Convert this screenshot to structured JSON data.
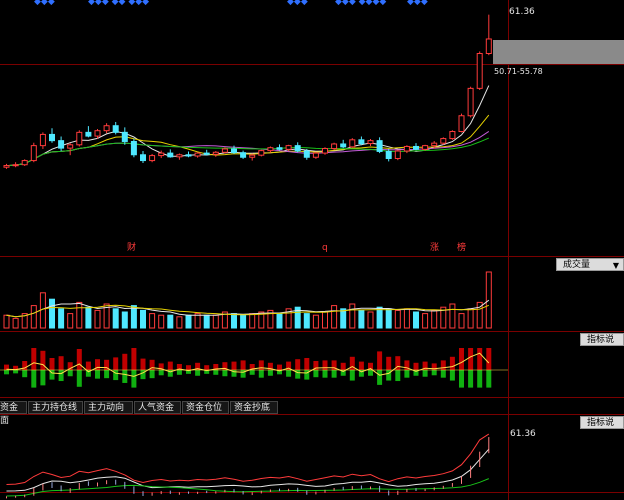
{
  "top_marks": [
    "◆◆◆",
    "◆◆◆ ◆◆ ◆◆◆",
    "◆◆◆",
    "◆◆◆ ◆◆◆◆",
    "◆◆◆"
  ],
  "colors": {
    "up": "#ff3b3b",
    "down": "#4fe8ff",
    "ma_white": "#e6e6e6",
    "ma_yellow": "#e6d200",
    "ma_green": "#19c019",
    "ma_purple": "#c35bd8",
    "grid": "#7a0000"
  },
  "main_chart": {
    "high_label": "61.36",
    "range_label": "50.71-55.78",
    "event_markers": [
      "财",
      "q",
      "涨",
      "榜"
    ]
  },
  "volume_panel": {
    "indicator_select": "成交量",
    "dropdown_icon": "triangle-down-icon"
  },
  "indicator_panel": {
    "help_button": "指标说明"
  },
  "tabs": [
    "资金面",
    "主力持仓线",
    "主力动向",
    "人气资金",
    "资金仓位",
    "资金抄底"
  ],
  "bottom_panel": {
    "help_button": "指标说明",
    "high_label": "61.36"
  },
  "chart_data": {
    "type": "candlestick",
    "series": [
      {
        "name": "price",
        "ohlc": [
          [
            24.6,
            25.4,
            24.2,
            25.0
          ],
          [
            25.0,
            25.8,
            24.6,
            25.2
          ],
          [
            25.2,
            26.5,
            24.9,
            26.2
          ],
          [
            26.2,
            30.5,
            25.8,
            29.8
          ],
          [
            29.8,
            33.0,
            29.0,
            32.5
          ],
          [
            32.5,
            34.0,
            30.5,
            31.0
          ],
          [
            31.0,
            32.0,
            28.5,
            29.2
          ],
          [
            29.2,
            30.4,
            27.5,
            30.0
          ],
          [
            30.0,
            33.5,
            29.6,
            33.0
          ],
          [
            33.0,
            34.5,
            31.8,
            32.1
          ],
          [
            32.1,
            33.8,
            31.5,
            33.4
          ],
          [
            33.4,
            35.2,
            32.8,
            34.6
          ],
          [
            34.6,
            35.5,
            32.5,
            33.0
          ],
          [
            33.0,
            34.2,
            30.0,
            30.8
          ],
          [
            30.8,
            31.5,
            27.0,
            27.6
          ],
          [
            27.6,
            28.5,
            25.6,
            26.2
          ],
          [
            26.2,
            27.8,
            25.8,
            27.4
          ],
          [
            27.4,
            28.6,
            26.8,
            28.0
          ],
          [
            28.0,
            28.9,
            26.9,
            27.1
          ],
          [
            27.1,
            27.9,
            26.4,
            27.6
          ],
          [
            27.6,
            28.4,
            27.0,
            27.3
          ],
          [
            27.3,
            28.2,
            26.9,
            28.0
          ],
          [
            28.0,
            28.8,
            27.4,
            27.7
          ],
          [
            27.7,
            28.5,
            27.1,
            28.2
          ],
          [
            28.2,
            29.4,
            27.9,
            29.0
          ],
          [
            29.0,
            29.8,
            27.8,
            28.1
          ],
          [
            28.1,
            28.6,
            26.6,
            27.0
          ],
          [
            27.0,
            27.9,
            26.2,
            27.5
          ],
          [
            27.5,
            28.8,
            27.2,
            28.6
          ],
          [
            28.6,
            29.6,
            28.1,
            29.3
          ],
          [
            29.3,
            30.1,
            28.6,
            28.9
          ],
          [
            28.9,
            30.0,
            28.5,
            29.8
          ],
          [
            29.8,
            30.6,
            28.2,
            28.5
          ],
          [
            28.5,
            29.0,
            26.4,
            27.0
          ],
          [
            27.0,
            28.3,
            26.6,
            28.0
          ],
          [
            28.0,
            29.4,
            27.6,
            29.1
          ],
          [
            29.1,
            30.5,
            28.8,
            30.2
          ],
          [
            30.2,
            31.2,
            29.2,
            29.5
          ],
          [
            29.5,
            31.6,
            29.3,
            31.2
          ],
          [
            31.2,
            32.0,
            29.9,
            30.3
          ],
          [
            30.3,
            31.4,
            29.7,
            31.0
          ],
          [
            31.0,
            31.8,
            28.0,
            28.4
          ],
          [
            28.4,
            29.0,
            26.0,
            26.7
          ],
          [
            26.7,
            28.8,
            26.3,
            28.5
          ],
          [
            28.5,
            29.9,
            28.0,
            29.6
          ],
          [
            29.6,
            30.4,
            28.7,
            28.9
          ],
          [
            28.9,
            30.0,
            28.6,
            29.8
          ],
          [
            29.8,
            30.9,
            29.1,
            30.4
          ],
          [
            30.4,
            31.8,
            30.0,
            31.5
          ],
          [
            31.5,
            33.5,
            31.2,
            33.2
          ],
          [
            33.2,
            37.5,
            33.0,
            37.0
          ],
          [
            37.0,
            44.0,
            36.6,
            43.6
          ],
          [
            43.6,
            52.5,
            43.2,
            52.0
          ],
          [
            52.0,
            61.36,
            51.6,
            55.5
          ]
        ]
      }
    ],
    "volume": [
      8,
      6,
      9,
      14,
      22,
      18,
      12,
      9,
      16,
      13,
      11,
      15,
      12,
      10,
      14,
      11,
      9,
      8,
      8,
      7,
      8,
      9,
      8,
      8,
      10,
      9,
      8,
      9,
      10,
      11,
      9,
      12,
      13,
      9,
      8,
      10,
      14,
      12,
      15,
      11,
      10,
      13,
      12,
      11,
      12,
      10,
      9,
      11,
      13,
      15,
      9,
      12,
      16,
      35
    ],
    "ylim": [
      22,
      62
    ]
  }
}
